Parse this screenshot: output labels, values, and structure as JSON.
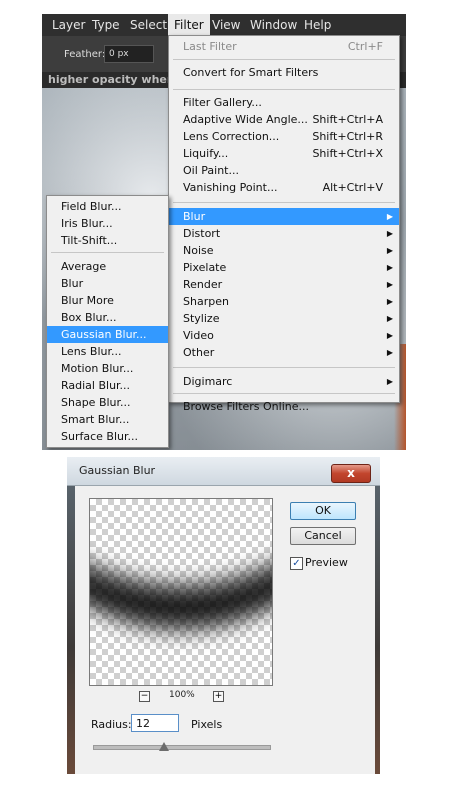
{
  "menubar": {
    "items": [
      {
        "label": "Layer"
      },
      {
        "label": "Type"
      },
      {
        "label": "Select"
      },
      {
        "label": "Filter"
      },
      {
        "label": "View"
      },
      {
        "label": "Window"
      },
      {
        "label": "Help"
      }
    ]
  },
  "options_bar": {
    "feather_label": "Feather:",
    "feather_value": "0 px"
  },
  "hint_text": "higher opacity  when pain",
  "filter_menu": {
    "items": [
      {
        "label": "Last Filter",
        "shortcut": "Ctrl+F",
        "disabled": true
      },
      {
        "label": "Convert for Smart Filters"
      },
      {
        "label": "Filter Gallery..."
      },
      {
        "label": "Adaptive Wide Angle...",
        "shortcut": "Shift+Ctrl+A"
      },
      {
        "label": "Lens Correction...",
        "shortcut": "Shift+Ctrl+R"
      },
      {
        "label": "Liquify...",
        "shortcut": "Shift+Ctrl+X"
      },
      {
        "label": "Oil Paint..."
      },
      {
        "label": "Vanishing Point...",
        "shortcut": "Alt+Ctrl+V"
      },
      {
        "label": "Blur",
        "selected": true,
        "submenu": true
      },
      {
        "label": "Distort",
        "submenu": true
      },
      {
        "label": "Noise",
        "submenu": true
      },
      {
        "label": "Pixelate",
        "submenu": true
      },
      {
        "label": "Render",
        "submenu": true
      },
      {
        "label": "Sharpen",
        "submenu": true
      },
      {
        "label": "Stylize",
        "submenu": true
      },
      {
        "label": "Video",
        "submenu": true
      },
      {
        "label": "Other",
        "submenu": true
      },
      {
        "label": "Digimarc",
        "submenu": true
      },
      {
        "label": "Browse Filters Online..."
      }
    ]
  },
  "blur_menu": {
    "items": [
      {
        "label": "Field Blur..."
      },
      {
        "label": "Iris Blur..."
      },
      {
        "label": "Tilt-Shift..."
      },
      {
        "label": "Average"
      },
      {
        "label": "Blur"
      },
      {
        "label": "Blur More"
      },
      {
        "label": "Box Blur..."
      },
      {
        "label": "Gaussian Blur...",
        "selected": true
      },
      {
        "label": "Lens Blur..."
      },
      {
        "label": "Motion Blur..."
      },
      {
        "label": "Radial Blur..."
      },
      {
        "label": "Shape Blur..."
      },
      {
        "label": "Smart Blur..."
      },
      {
        "label": "Surface Blur..."
      }
    ]
  },
  "dialog": {
    "title": "Gaussian Blur",
    "close_label": "x",
    "ok_label": "OK",
    "cancel_label": "Cancel",
    "preview_label": "Preview",
    "preview_checked": true,
    "zoom_minus": "−",
    "zoom_level": "100%",
    "zoom_plus": "+",
    "radius_label": "Radius:",
    "radius_value": "12",
    "radius_unit": "Pixels",
    "radius_slider_fraction": 0.4
  },
  "colors": {
    "menu_highlight": "#3399ff",
    "menubar_bg": "#2f2f2f",
    "close_button": "#c2452d"
  },
  "icons": {
    "submenu_arrow": "submenu-arrow-icon",
    "checkmark": "checkmark-icon",
    "close": "close-icon",
    "zoom_out": "zoom-out-icon",
    "zoom_in": "zoom-in-icon"
  }
}
